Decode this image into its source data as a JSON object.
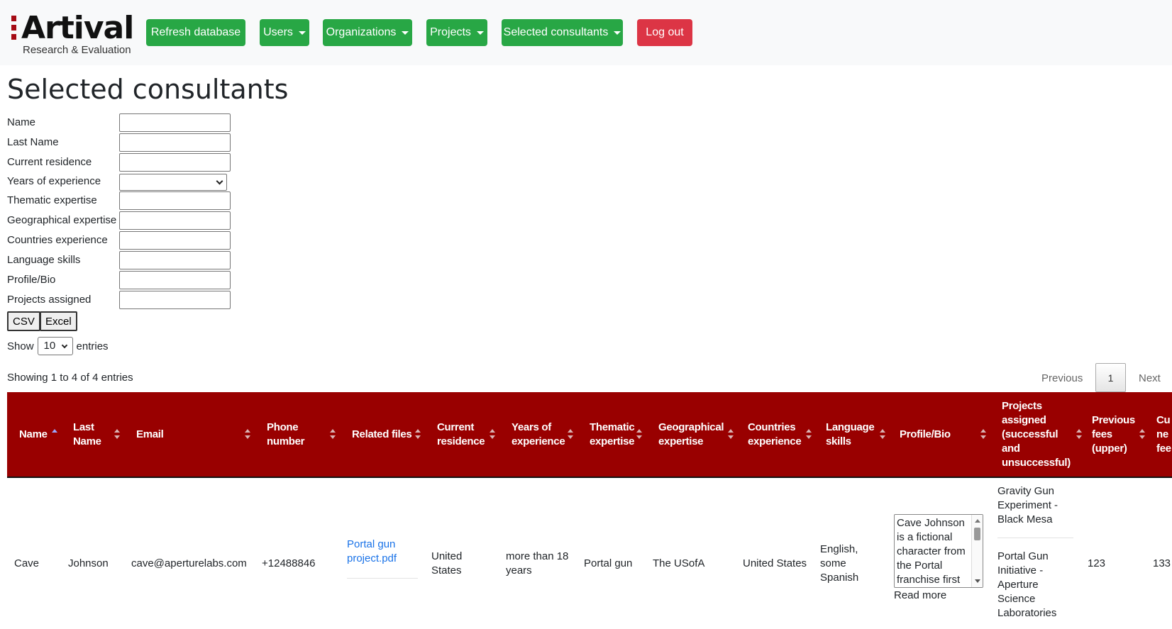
{
  "brand": {
    "name": "Artival",
    "tagline": "Research & Evaluation"
  },
  "nav": {
    "refresh": "Refresh database",
    "users": "Users",
    "organizations": "Organizations",
    "projects": "Projects",
    "selected": "Selected consultants",
    "logout": "Log out"
  },
  "page_title": "Selected consultants",
  "filters": {
    "name": "Name",
    "last_name": "Last Name",
    "residence": "Current residence",
    "years": "Years of experience",
    "thematic": "Thematic expertise",
    "geographical": "Geographical expertise",
    "countries": "Countries experience",
    "language": "Language skills",
    "bio": "Profile/Bio",
    "projects": "Projects assigned"
  },
  "export": {
    "csv": "CSV",
    "excel": "Excel"
  },
  "length": {
    "show": "Show",
    "value": "10",
    "entries": "entries"
  },
  "info": "Showing 1 to 4 of 4 entries",
  "pagination": {
    "previous": "Previous",
    "page": "1",
    "next": "Next"
  },
  "table": {
    "headers": {
      "name": "Name",
      "last_name_1": "Last",
      "last_name_2": "Name",
      "email": "Email",
      "phone_1": "Phone",
      "phone_2": "number",
      "files": "Related files",
      "residence_1": "Current",
      "residence_2": "residence",
      "years_1": "Years of",
      "years_2": "experience",
      "thematic_1": "Thematic",
      "thematic_2": "expertise",
      "geo_1": "Geographical",
      "geo_2": "expertise",
      "countries_1": "Countries",
      "countries_2": "experience",
      "lang_1": "Language",
      "lang_2": "skills",
      "bio": "Profile/Bio",
      "proj_1": "Projects",
      "proj_2": "assigned",
      "proj_3": "(successful",
      "proj_4": "and",
      "proj_5": "unsuccessful)",
      "fees_1": "Previous",
      "fees_2": "fees",
      "fees_3": "(upper)",
      "cur_1": "Cu",
      "cur_2": "ne",
      "cur_3": "fee"
    },
    "row": {
      "name": "Cave",
      "last_name": "Johnson",
      "email": "cave@aperturelabs.com",
      "phone": "+12488846",
      "file_1": "Portal gun",
      "file_2": "project.pdf",
      "residence_1": "United",
      "residence_2": "States",
      "years_1": "more than 18",
      "years_2": "years",
      "thematic": "Portal gun",
      "geo": "The USofA",
      "countries": "United States",
      "lang_1": "English,",
      "lang_2": "some",
      "lang_3": "Spanish",
      "bio_text": "Cave Johnson is a fictional character from the Portal franchise first",
      "read_more": "Read more",
      "proj_a_1": "Gravity Gun",
      "proj_a_2": "Experiment -",
      "proj_a_3": "Black Mesa",
      "proj_b_1": "Portal Gun",
      "proj_b_2": "Initiative -",
      "proj_b_3": "Aperture",
      "proj_b_4": "Science",
      "proj_b_5": "Laboratories",
      "fees": "123",
      "current_fees": "133"
    }
  },
  "colors": {
    "nav_green": "#28a745",
    "logout_red": "#dc3545",
    "header_red": "#990000"
  }
}
